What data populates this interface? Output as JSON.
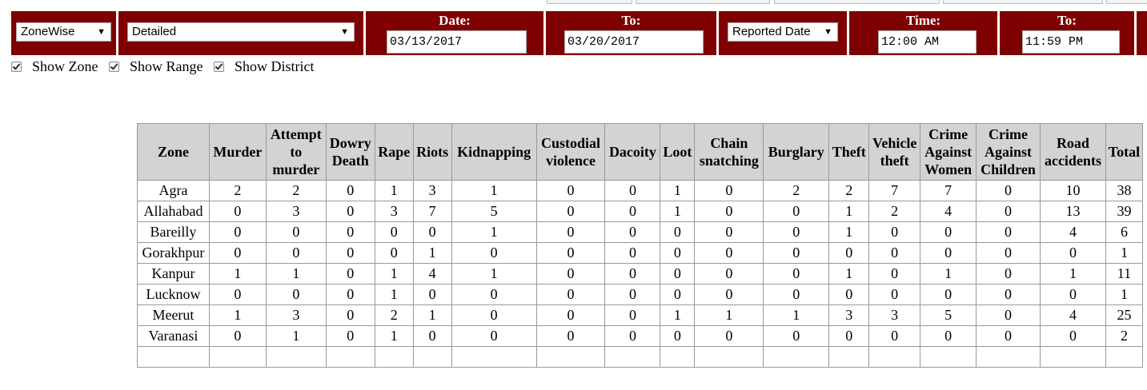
{
  "filters": {
    "mode": {
      "value": "ZoneWise"
    },
    "detail": {
      "value": "Detailed"
    },
    "date_from": {
      "label": "Date:",
      "value": "03/13/2017"
    },
    "date_to": {
      "label": "To:",
      "value": "03/20/2017"
    },
    "date_type": {
      "value": "Reported Date"
    },
    "time_from": {
      "label": "Time:",
      "value": "12:00 AM"
    },
    "time_to": {
      "label": "To:",
      "value": "11:59 PM"
    }
  },
  "checkboxes": [
    {
      "label": "Show Zone",
      "checked": true
    },
    {
      "label": "Show Range",
      "checked": true
    },
    {
      "label": "Show District",
      "checked": true
    }
  ],
  "table": {
    "headers": [
      "Zone",
      "Murder",
      "Attempt to murder",
      "Dowry Death",
      "Rape",
      "Riots",
      "Kidnapping",
      "Custodial violence",
      "Dacoity",
      "Loot",
      "Chain snatching",
      "Burglary",
      "Theft",
      "Vehicle theft",
      "Crime Against Women",
      "Crime Against Children",
      "Road accidents",
      "Total"
    ],
    "rows": [
      [
        "Agra",
        "2",
        "2",
        "0",
        "1",
        "3",
        "1",
        "0",
        "0",
        "1",
        "0",
        "2",
        "2",
        "7",
        "7",
        "0",
        "10",
        "38"
      ],
      [
        "Allahabad",
        "0",
        "3",
        "0",
        "3",
        "7",
        "5",
        "0",
        "0",
        "1",
        "0",
        "0",
        "1",
        "2",
        "4",
        "0",
        "13",
        "39"
      ],
      [
        "Bareilly",
        "0",
        "0",
        "0",
        "0",
        "0",
        "1",
        "0",
        "0",
        "0",
        "0",
        "0",
        "1",
        "0",
        "0",
        "0",
        "4",
        "6"
      ],
      [
        "Gorakhpur",
        "0",
        "0",
        "0",
        "0",
        "1",
        "0",
        "0",
        "0",
        "0",
        "0",
        "0",
        "0",
        "0",
        "0",
        "0",
        "0",
        "1"
      ],
      [
        "Kanpur",
        "1",
        "1",
        "0",
        "1",
        "4",
        "1",
        "0",
        "0",
        "0",
        "0",
        "0",
        "1",
        "0",
        "1",
        "0",
        "1",
        "11"
      ],
      [
        "Lucknow",
        "0",
        "0",
        "0",
        "1",
        "0",
        "0",
        "0",
        "0",
        "0",
        "0",
        "0",
        "0",
        "0",
        "0",
        "0",
        "0",
        "1"
      ],
      [
        "Meerut",
        "1",
        "3",
        "0",
        "2",
        "1",
        "0",
        "0",
        "0",
        "1",
        "1",
        "1",
        "3",
        "3",
        "5",
        "0",
        "4",
        "25"
      ],
      [
        "Varanasi",
        "0",
        "1",
        "0",
        "1",
        "0",
        "0",
        "0",
        "0",
        "0",
        "0",
        "0",
        "0",
        "0",
        "0",
        "0",
        "0",
        "2"
      ]
    ]
  },
  "colors": {
    "bar": "#7f0000",
    "header_bg": "#d3d3d3"
  }
}
